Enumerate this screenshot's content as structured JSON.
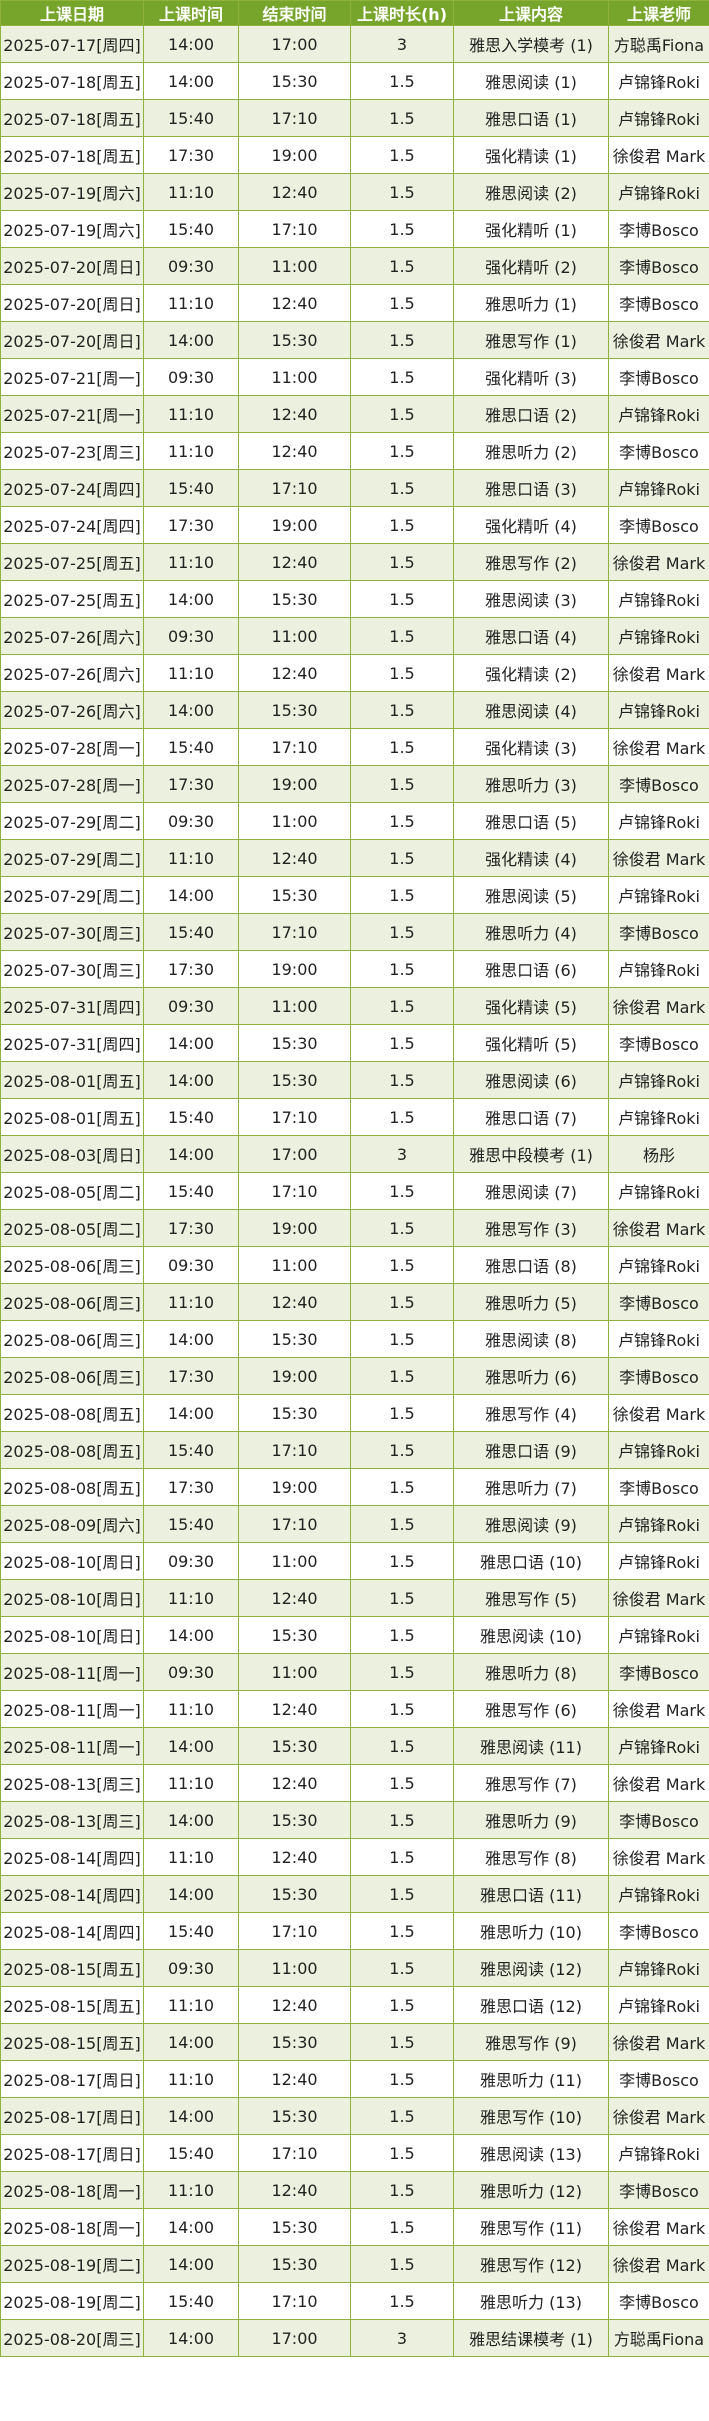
{
  "headers": [
    "上课日期",
    "上课时间",
    "结束时间",
    "上课时长(h)",
    "上课内容",
    "上课老师"
  ],
  "rows": [
    [
      "2025-07-17[周四]",
      "14:00",
      "17:00",
      "3",
      "雅思入学模考 (1)",
      "方聪禹Fiona"
    ],
    [
      "2025-07-18[周五]",
      "14:00",
      "15:30",
      "1.5",
      "雅思阅读 (1)",
      "卢锦锋Roki"
    ],
    [
      "2025-07-18[周五]",
      "15:40",
      "17:10",
      "1.5",
      "雅思口语 (1)",
      "卢锦锋Roki"
    ],
    [
      "2025-07-18[周五]",
      "17:30",
      "19:00",
      "1.5",
      "强化精读 (1)",
      "徐俊君 Mark"
    ],
    [
      "2025-07-19[周六]",
      "11:10",
      "12:40",
      "1.5",
      "雅思阅读 (2)",
      "卢锦锋Roki"
    ],
    [
      "2025-07-19[周六]",
      "15:40",
      "17:10",
      "1.5",
      "强化精听 (1)",
      "李博Bosco"
    ],
    [
      "2025-07-20[周日]",
      "09:30",
      "11:00",
      "1.5",
      "强化精听 (2)",
      "李博Bosco"
    ],
    [
      "2025-07-20[周日]",
      "11:10",
      "12:40",
      "1.5",
      "雅思听力 (1)",
      "李博Bosco"
    ],
    [
      "2025-07-20[周日]",
      "14:00",
      "15:30",
      "1.5",
      "雅思写作 (1)",
      "徐俊君 Mark"
    ],
    [
      "2025-07-21[周一]",
      "09:30",
      "11:00",
      "1.5",
      "强化精听 (3)",
      "李博Bosco"
    ],
    [
      "2025-07-21[周一]",
      "11:10",
      "12:40",
      "1.5",
      "雅思口语 (2)",
      "卢锦锋Roki"
    ],
    [
      "2025-07-23[周三]",
      "11:10",
      "12:40",
      "1.5",
      "雅思听力 (2)",
      "李博Bosco"
    ],
    [
      "2025-07-24[周四]",
      "15:40",
      "17:10",
      "1.5",
      "雅思口语 (3)",
      "卢锦锋Roki"
    ],
    [
      "2025-07-24[周四]",
      "17:30",
      "19:00",
      "1.5",
      "强化精听 (4)",
      "李博Bosco"
    ],
    [
      "2025-07-25[周五]",
      "11:10",
      "12:40",
      "1.5",
      "雅思写作 (2)",
      "徐俊君 Mark"
    ],
    [
      "2025-07-25[周五]",
      "14:00",
      "15:30",
      "1.5",
      "雅思阅读 (3)",
      "卢锦锋Roki"
    ],
    [
      "2025-07-26[周六]",
      "09:30",
      "11:00",
      "1.5",
      "雅思口语 (4)",
      "卢锦锋Roki"
    ],
    [
      "2025-07-26[周六]",
      "11:10",
      "12:40",
      "1.5",
      "强化精读 (2)",
      "徐俊君 Mark"
    ],
    [
      "2025-07-26[周六]",
      "14:00",
      "15:30",
      "1.5",
      "雅思阅读 (4)",
      "卢锦锋Roki"
    ],
    [
      "2025-07-28[周一]",
      "15:40",
      "17:10",
      "1.5",
      "强化精读 (3)",
      "徐俊君 Mark"
    ],
    [
      "2025-07-28[周一]",
      "17:30",
      "19:00",
      "1.5",
      "雅思听力 (3)",
      "李博Bosco"
    ],
    [
      "2025-07-29[周二]",
      "09:30",
      "11:00",
      "1.5",
      "雅思口语 (5)",
      "卢锦锋Roki"
    ],
    [
      "2025-07-29[周二]",
      "11:10",
      "12:40",
      "1.5",
      "强化精读 (4)",
      "徐俊君 Mark"
    ],
    [
      "2025-07-29[周二]",
      "14:00",
      "15:30",
      "1.5",
      "雅思阅读 (5)",
      "卢锦锋Roki"
    ],
    [
      "2025-07-30[周三]",
      "15:40",
      "17:10",
      "1.5",
      "雅思听力 (4)",
      "李博Bosco"
    ],
    [
      "2025-07-30[周三]",
      "17:30",
      "19:00",
      "1.5",
      "雅思口语 (6)",
      "卢锦锋Roki"
    ],
    [
      "2025-07-31[周四]",
      "09:30",
      "11:00",
      "1.5",
      "强化精读 (5)",
      "徐俊君 Mark"
    ],
    [
      "2025-07-31[周四]",
      "14:00",
      "15:30",
      "1.5",
      "强化精听 (5)",
      "李博Bosco"
    ],
    [
      "2025-08-01[周五]",
      "14:00",
      "15:30",
      "1.5",
      "雅思阅读 (6)",
      "卢锦锋Roki"
    ],
    [
      "2025-08-01[周五]",
      "15:40",
      "17:10",
      "1.5",
      "雅思口语 (7)",
      "卢锦锋Roki"
    ],
    [
      "2025-08-03[周日]",
      "14:00",
      "17:00",
      "3",
      "雅思中段模考 (1)",
      "杨彤"
    ],
    [
      "2025-08-05[周二]",
      "15:40",
      "17:10",
      "1.5",
      "雅思阅读 (7)",
      "卢锦锋Roki"
    ],
    [
      "2025-08-05[周二]",
      "17:30",
      "19:00",
      "1.5",
      "雅思写作 (3)",
      "徐俊君 Mark"
    ],
    [
      "2025-08-06[周三]",
      "09:30",
      "11:00",
      "1.5",
      "雅思口语 (8)",
      "卢锦锋Roki"
    ],
    [
      "2025-08-06[周三]",
      "11:10",
      "12:40",
      "1.5",
      "雅思听力 (5)",
      "李博Bosco"
    ],
    [
      "2025-08-06[周三]",
      "14:00",
      "15:30",
      "1.5",
      "雅思阅读 (8)",
      "卢锦锋Roki"
    ],
    [
      "2025-08-06[周三]",
      "17:30",
      "19:00",
      "1.5",
      "雅思听力 (6)",
      "李博Bosco"
    ],
    [
      "2025-08-08[周五]",
      "14:00",
      "15:30",
      "1.5",
      "雅思写作 (4)",
      "徐俊君 Mark"
    ],
    [
      "2025-08-08[周五]",
      "15:40",
      "17:10",
      "1.5",
      "雅思口语 (9)",
      "卢锦锋Roki"
    ],
    [
      "2025-08-08[周五]",
      "17:30",
      "19:00",
      "1.5",
      "雅思听力 (7)",
      "李博Bosco"
    ],
    [
      "2025-08-09[周六]",
      "15:40",
      "17:10",
      "1.5",
      "雅思阅读 (9)",
      "卢锦锋Roki"
    ],
    [
      "2025-08-10[周日]",
      "09:30",
      "11:00",
      "1.5",
      "雅思口语 (10)",
      "卢锦锋Roki"
    ],
    [
      "2025-08-10[周日]",
      "11:10",
      "12:40",
      "1.5",
      "雅思写作 (5)",
      "徐俊君 Mark"
    ],
    [
      "2025-08-10[周日]",
      "14:00",
      "15:30",
      "1.5",
      "雅思阅读 (10)",
      "卢锦锋Roki"
    ],
    [
      "2025-08-11[周一]",
      "09:30",
      "11:00",
      "1.5",
      "雅思听力 (8)",
      "李博Bosco"
    ],
    [
      "2025-08-11[周一]",
      "11:10",
      "12:40",
      "1.5",
      "雅思写作 (6)",
      "徐俊君 Mark"
    ],
    [
      "2025-08-11[周一]",
      "14:00",
      "15:30",
      "1.5",
      "雅思阅读 (11)",
      "卢锦锋Roki"
    ],
    [
      "2025-08-13[周三]",
      "11:10",
      "12:40",
      "1.5",
      "雅思写作 (7)",
      "徐俊君 Mark"
    ],
    [
      "2025-08-13[周三]",
      "14:00",
      "15:30",
      "1.5",
      "雅思听力 (9)",
      "李博Bosco"
    ],
    [
      "2025-08-14[周四]",
      "11:10",
      "12:40",
      "1.5",
      "雅思写作 (8)",
      "徐俊君 Mark"
    ],
    [
      "2025-08-14[周四]",
      "14:00",
      "15:30",
      "1.5",
      "雅思口语 (11)",
      "卢锦锋Roki"
    ],
    [
      "2025-08-14[周四]",
      "15:40",
      "17:10",
      "1.5",
      "雅思听力 (10)",
      "李博Bosco"
    ],
    [
      "2025-08-15[周五]",
      "09:30",
      "11:00",
      "1.5",
      "雅思阅读 (12)",
      "卢锦锋Roki"
    ],
    [
      "2025-08-15[周五]",
      "11:10",
      "12:40",
      "1.5",
      "雅思口语 (12)",
      "卢锦锋Roki"
    ],
    [
      "2025-08-15[周五]",
      "14:00",
      "15:30",
      "1.5",
      "雅思写作 (9)",
      "徐俊君 Mark"
    ],
    [
      "2025-08-17[周日]",
      "11:10",
      "12:40",
      "1.5",
      "雅思听力 (11)",
      "李博Bosco"
    ],
    [
      "2025-08-17[周日]",
      "14:00",
      "15:30",
      "1.5",
      "雅思写作 (10)",
      "徐俊君 Mark"
    ],
    [
      "2025-08-17[周日]",
      "15:40",
      "17:10",
      "1.5",
      "雅思阅读 (13)",
      "卢锦锋Roki"
    ],
    [
      "2025-08-18[周一]",
      "11:10",
      "12:40",
      "1.5",
      "雅思听力 (12)",
      "李博Bosco"
    ],
    [
      "2025-08-18[周一]",
      "14:00",
      "15:30",
      "1.5",
      "雅思写作 (11)",
      "徐俊君 Mark"
    ],
    [
      "2025-08-19[周二]",
      "14:00",
      "15:30",
      "1.5",
      "雅思写作 (12)",
      "徐俊君 Mark"
    ],
    [
      "2025-08-19[周二]",
      "15:40",
      "17:10",
      "1.5",
      "雅思听力 (13)",
      "李博Bosco"
    ],
    [
      "2025-08-20[周三]",
      "14:00",
      "17:00",
      "3",
      "雅思结课模考 (1)",
      "方聪禹Fiona"
    ]
  ]
}
